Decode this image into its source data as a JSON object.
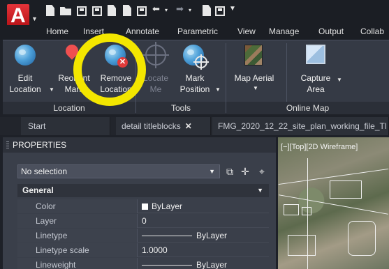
{
  "app": {
    "logo_letter": "A"
  },
  "ribbon_tabs": [
    "Home",
    "Insert",
    "Annotate",
    "Parametric",
    "View",
    "Manage",
    "Output",
    "Collab"
  ],
  "ribbon": {
    "panels": {
      "location": {
        "title": "Location",
        "buttons": [
          {
            "line1": "Edit",
            "line2": "Location",
            "has_dropdown": true,
            "icon": "globe-icon"
          },
          {
            "line1": "Reorient",
            "line2": "Mark",
            "icon": "map-pin-icon"
          },
          {
            "line1": "Remove",
            "line2": "Location",
            "icon": "globe-remove-icon"
          }
        ]
      },
      "tools": {
        "title": "Tools",
        "buttons": [
          {
            "line1": "Locate",
            "line2": "Me",
            "disabled": true,
            "icon": "locate-me-icon"
          },
          {
            "line1": "Mark",
            "line2": "Position",
            "has_dropdown": true,
            "icon": "globe-marker-icon"
          }
        ]
      },
      "online_map": {
        "title": "Online Map",
        "buttons": [
          {
            "line1": "Map Aerial",
            "has_dropdown": true,
            "icon": "aerial-map-icon"
          },
          {
            "line1": "Capture",
            "line2": "Area",
            "has_dropdown": true,
            "icon": "capture-area-icon"
          }
        ]
      }
    }
  },
  "file_tabs": [
    {
      "label": "Start"
    },
    {
      "label": "detail titleblocks",
      "closable": true,
      "close_glyph": "✕"
    },
    {
      "label": "FMG_2020_12_22_site_plan_working_file_Tl"
    }
  ],
  "properties": {
    "title": "PROPERTIES",
    "selection": "No selection",
    "section": "General",
    "rows": [
      {
        "label": "Color",
        "value": "ByLayer",
        "kind": "color"
      },
      {
        "label": "Layer",
        "value": "0"
      },
      {
        "label": "Linetype",
        "value": "ByLayer",
        "kind": "line"
      },
      {
        "label": "Linetype scale",
        "value": "1.0000"
      },
      {
        "label": "Lineweight",
        "value": "ByLayer",
        "kind": "line"
      }
    ]
  },
  "viewport": {
    "label": "[−][Top][2D Wireframe]"
  },
  "colors": {
    "annotation_ring": "#f3e600",
    "ribbon_bg": "#353a45",
    "app_logo": "#d42127"
  }
}
